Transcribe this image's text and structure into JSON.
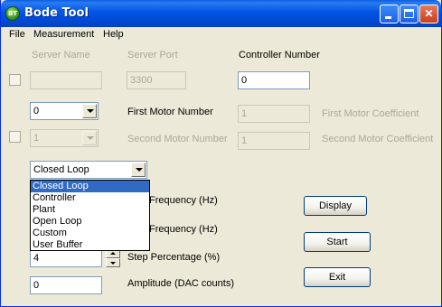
{
  "window": {
    "title": "Bode Tool",
    "icon": "app-logo-icon"
  },
  "menu": [
    {
      "label": "File"
    },
    {
      "label": "Measurement"
    },
    {
      "label": "Help"
    }
  ],
  "server": {
    "name_label": "Server Name",
    "name_value": "",
    "port_label": "Server Port",
    "port_value": "3300",
    "controller_label": "Controller Number",
    "controller_value": "0"
  },
  "motors": {
    "first_motor_select": "0",
    "first_motor_label": "First Motor Number",
    "first_coeff_value": "1",
    "first_coeff_label": "First Motor Coefficient",
    "second_motor_select": "1",
    "second_motor_label": "Second Motor Number",
    "second_coeff_value": "1",
    "second_coeff_label": "Second Motor Coefficient"
  },
  "mode": {
    "selected": "Closed Loop",
    "options": [
      "Closed Loop",
      "Controller",
      "Plant",
      "Open Loop",
      "Custom",
      "User Buffer"
    ]
  },
  "params": {
    "start_freq_label": "Frequency (Hz)",
    "end_freq_label": "Frequency (Hz)",
    "step_label": "Step Percentage (%)",
    "step_value": "4",
    "amp_label": "Amplitude (DAC counts)",
    "amp_value": "0"
  },
  "buttons": {
    "display": "Display",
    "start": "Start",
    "exit": "Exit"
  }
}
